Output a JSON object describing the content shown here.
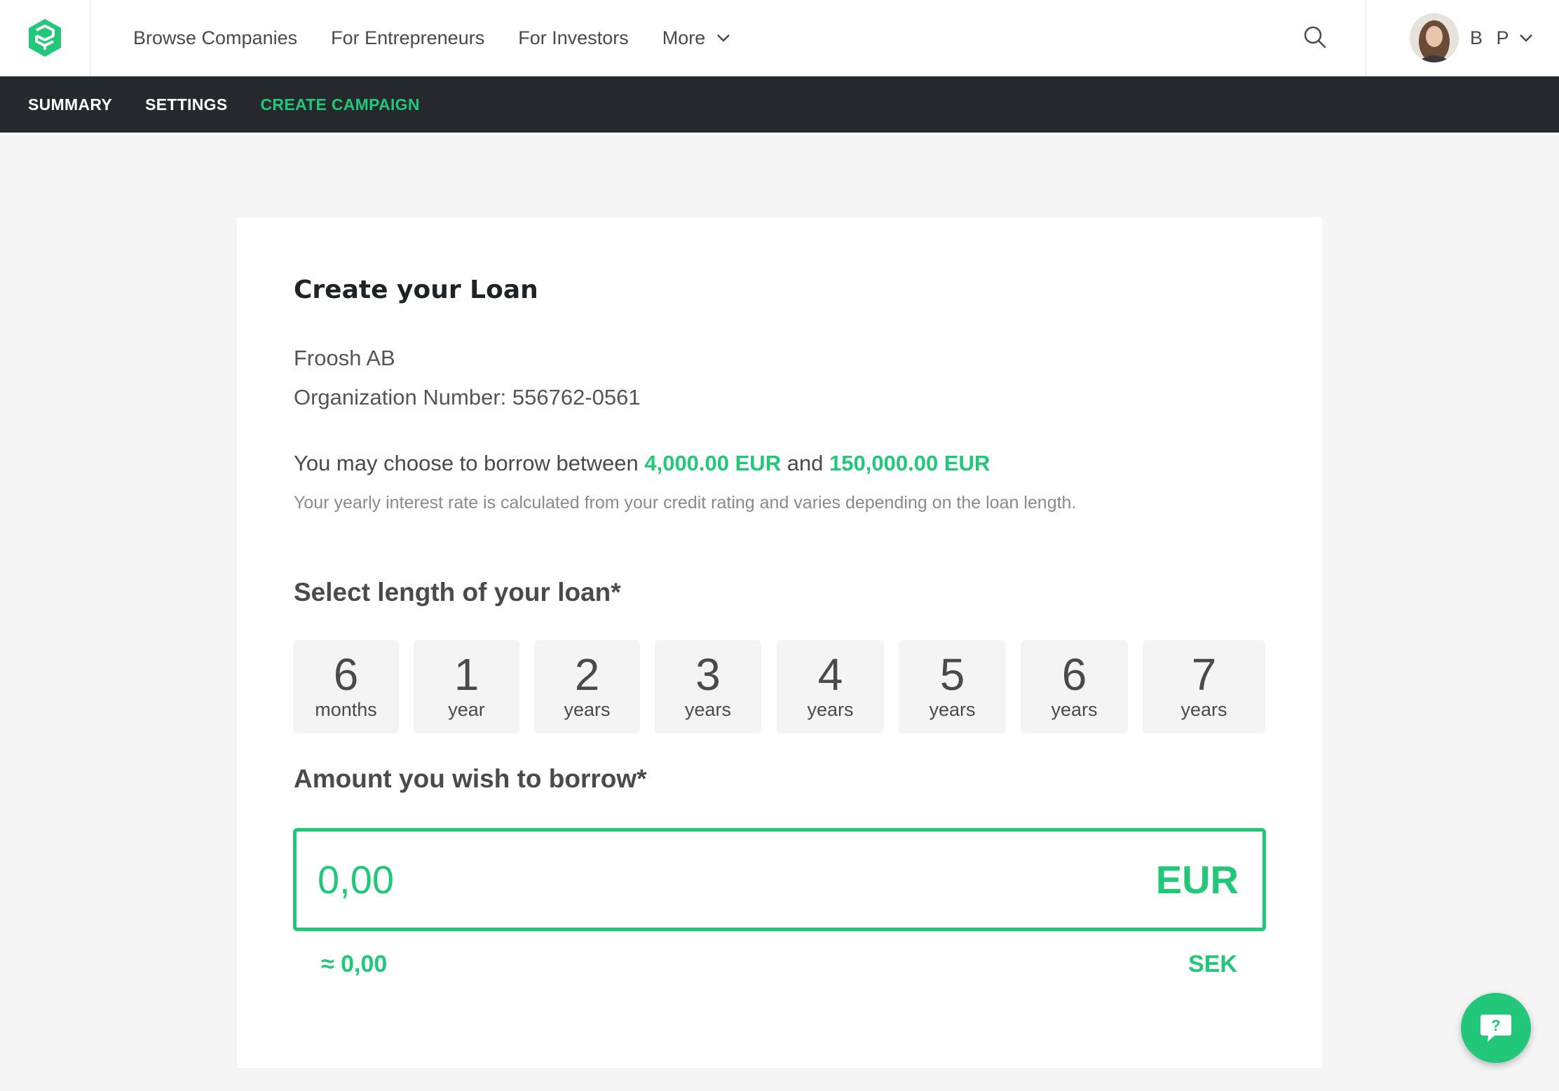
{
  "header": {
    "logo_icon": "brand-logo-icon",
    "nav": [
      {
        "label": "Browse Companies"
      },
      {
        "label": "For Entrepreneurs"
      },
      {
        "label": "For Investors"
      },
      {
        "label": "More"
      }
    ],
    "search_icon": "search-icon",
    "user": {
      "initials": "B P",
      "avatar_icon": "user-avatar"
    }
  },
  "subnav": {
    "items": [
      {
        "label": "SUMMARY"
      },
      {
        "label": "SETTINGS"
      },
      {
        "label": "CREATE CAMPAIGN",
        "active": true
      }
    ]
  },
  "loan": {
    "title": "Create your Loan",
    "company": "Froosh AB",
    "org_number": "Organization Number: 556762-0561",
    "borrow_prefix": "You may choose to borrow between",
    "min_amount": "4,000.00 EUR",
    "borrow_and": "and",
    "max_amount": "150,000.00 EUR",
    "rate_note": "Your yearly interest rate is calculated from your credit rating and varies depending on the loan length.",
    "length_title": "Select length of your loan*",
    "lengths": [
      {
        "num": "6",
        "unit": "months"
      },
      {
        "num": "1",
        "unit": "year"
      },
      {
        "num": "2",
        "unit": "years"
      },
      {
        "num": "3",
        "unit": "years"
      },
      {
        "num": "4",
        "unit": "years"
      },
      {
        "num": "5",
        "unit": "years"
      },
      {
        "num": "6",
        "unit": "years"
      },
      {
        "num": "7",
        "unit": "years"
      }
    ],
    "amount_title": "Amount you wish to borrow*",
    "amount_value": "0,00",
    "amount_currency": "EUR",
    "approx_value": "≈ 0,00",
    "approx_currency": "SEK"
  },
  "help": {
    "icon": "help-chat-icon",
    "glyph": "?"
  },
  "colors": {
    "accent": "#22c77a",
    "subnav_bg": "#25282c",
    "page_bg": "#f5f5f5"
  }
}
